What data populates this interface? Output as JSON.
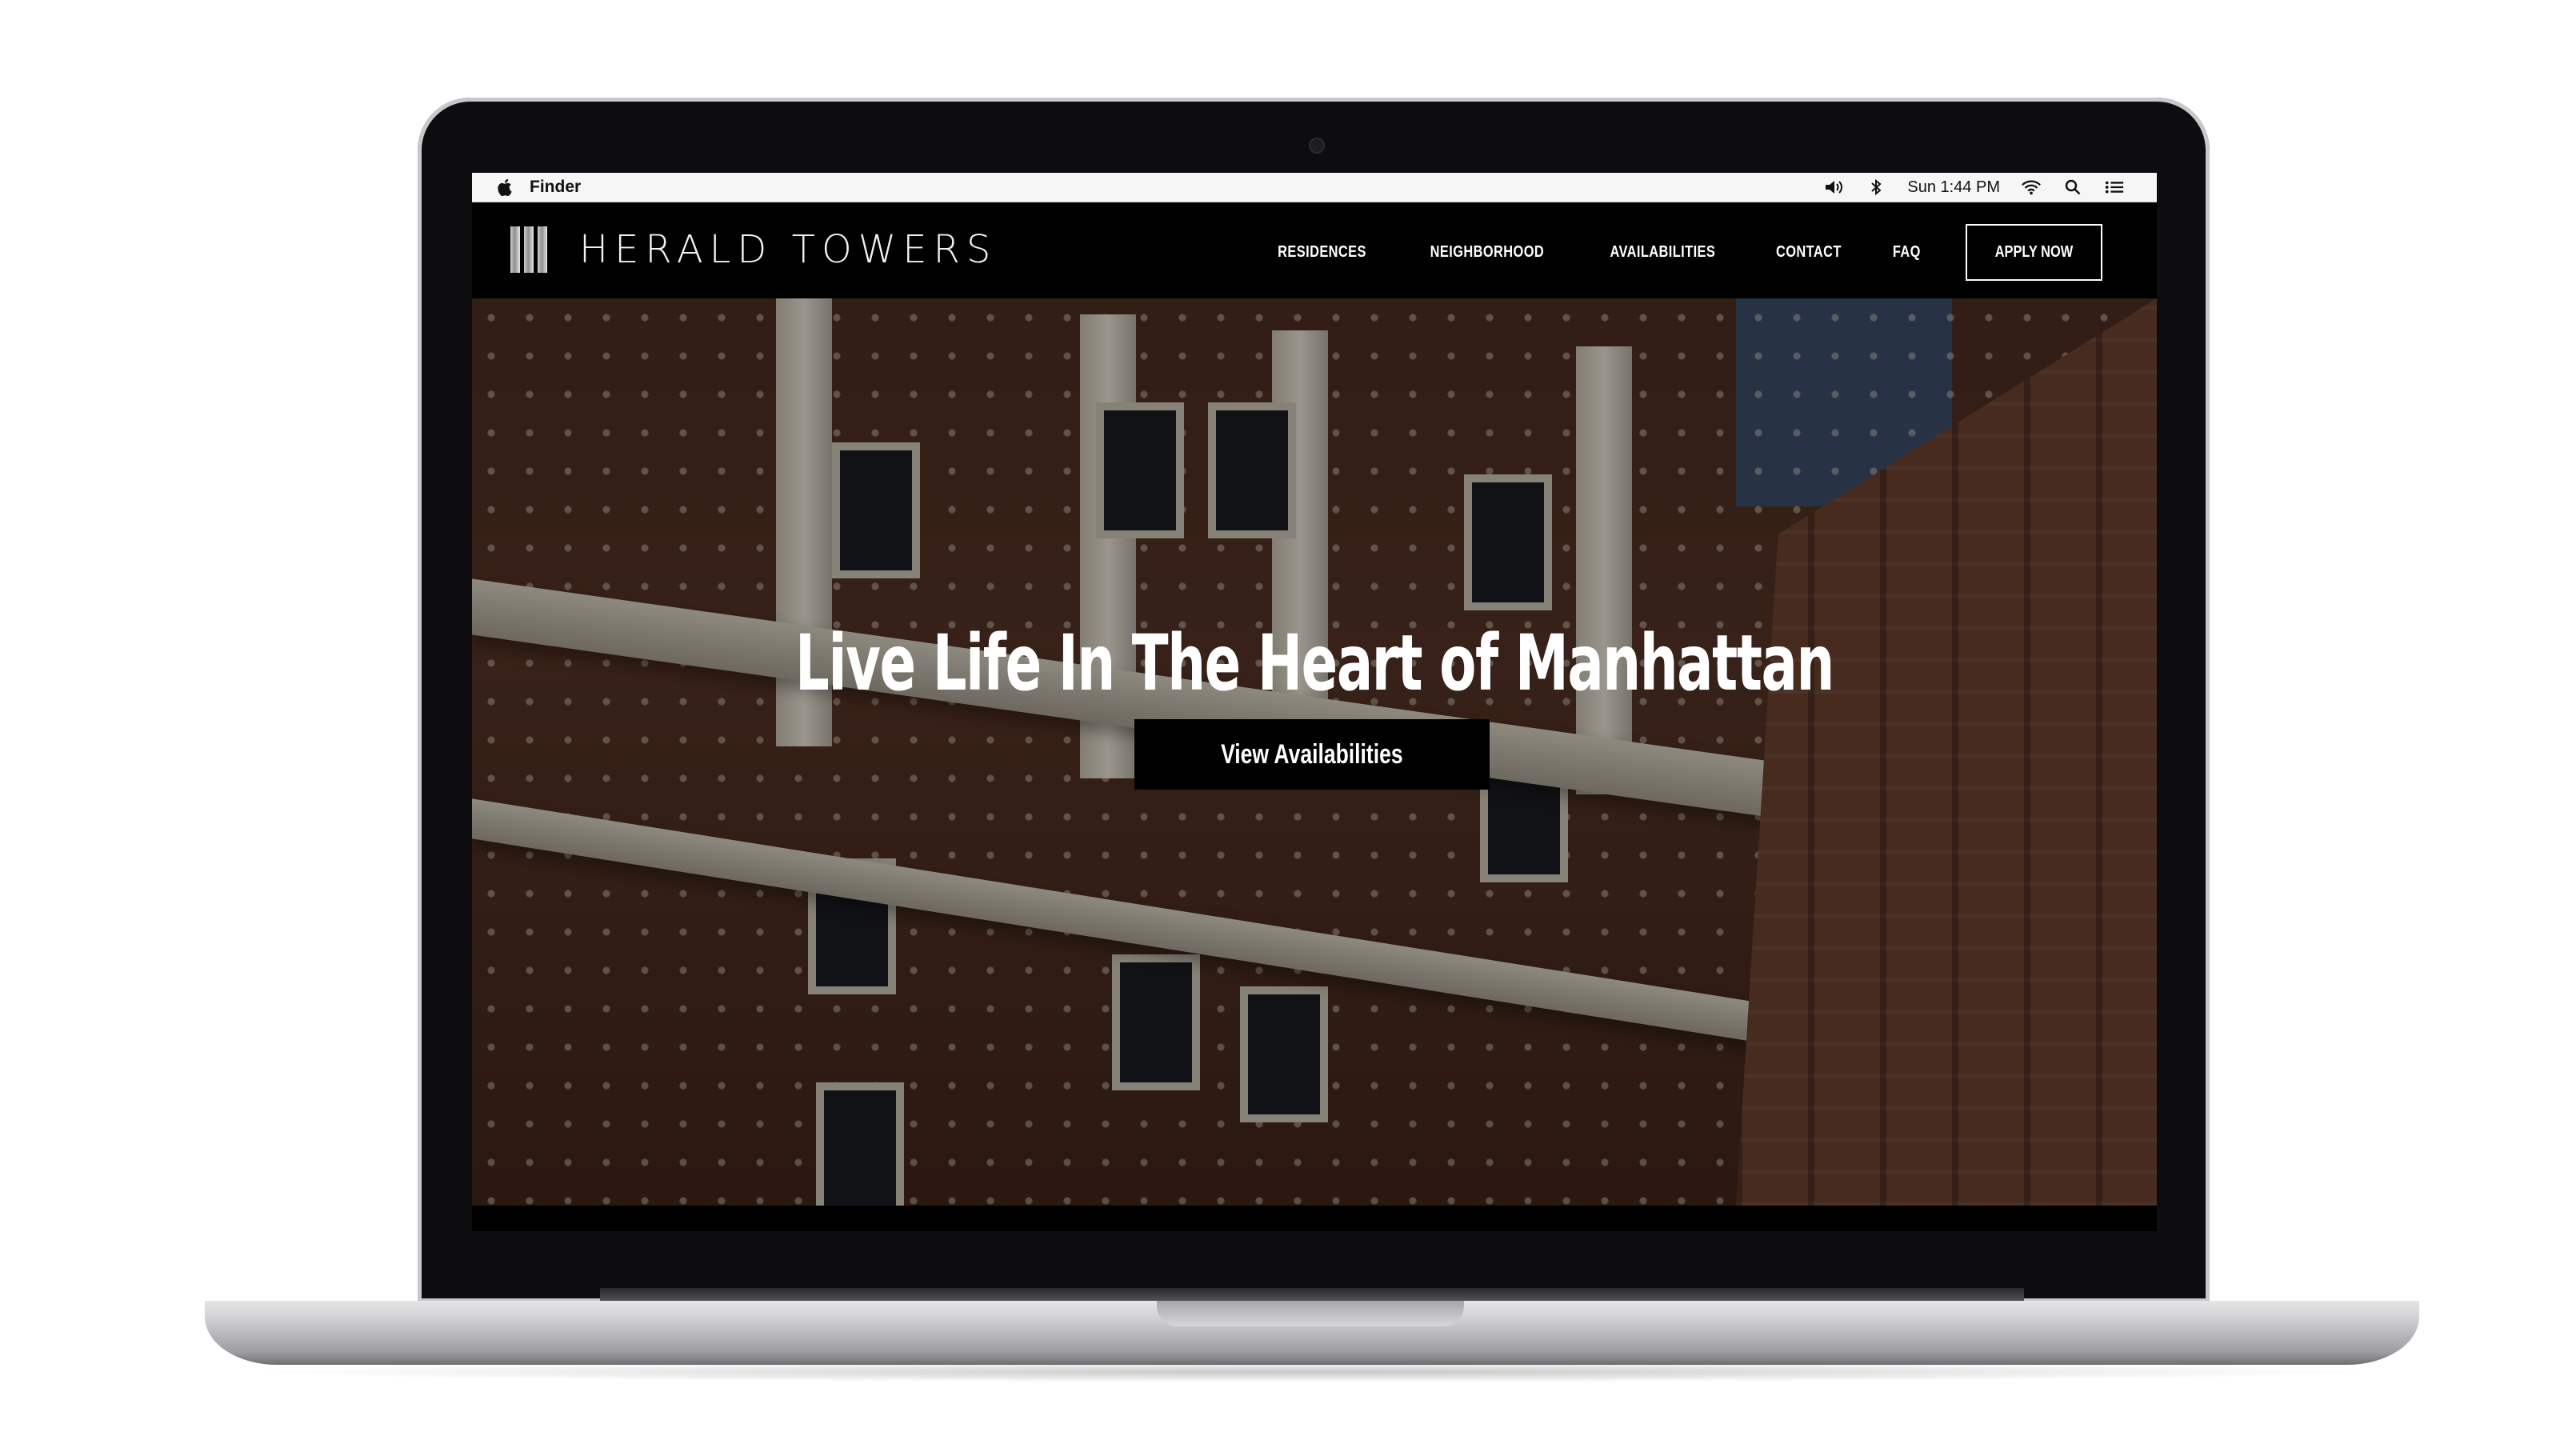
{
  "menubar": {
    "app_name": "Finder",
    "clock": "Sun 1:44 PM",
    "icons": [
      "apple-icon",
      "volume-icon",
      "bluetooth-icon",
      "wifi-icon",
      "search-icon",
      "list-icon"
    ]
  },
  "site": {
    "brand": "HERALD TOWERS",
    "nav": [
      "RESIDENCES",
      "NEIGHBORHOOD",
      "AVAILABILITIES",
      "CONTACT",
      "FAQ"
    ],
    "apply_label": "APPLY NOW"
  },
  "hero": {
    "title": "Live Life In The Heart of Manhattan",
    "cta_label": "View Availabilities"
  },
  "colors": {
    "header_bg": "#000000",
    "menubar_bg": "#f6f6f6",
    "hero_text": "#ffffff"
  }
}
